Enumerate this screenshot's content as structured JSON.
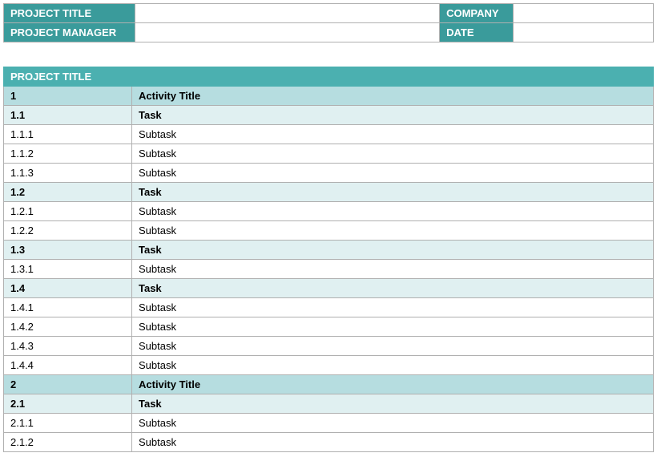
{
  "header": {
    "projectTitleLabel": "PROJECT TITLE",
    "projectTitleValue": "",
    "companyLabel": "COMPANY",
    "companyValue": "",
    "projectManagerLabel": "PROJECT MANAGER",
    "projectManagerValue": "",
    "dateLabel": "DATE",
    "dateValue": ""
  },
  "section": {
    "title": "PROJECT TITLE"
  },
  "rows": [
    {
      "id": "1",
      "text": "Activity Title",
      "level": 0
    },
    {
      "id": "1.1",
      "text": "Task",
      "level": 1
    },
    {
      "id": "1.1.1",
      "text": "Subtask",
      "level": 2
    },
    {
      "id": "1.1.2",
      "text": "Subtask",
      "level": 2
    },
    {
      "id": "1.1.3",
      "text": "Subtask",
      "level": 2
    },
    {
      "id": "1.2",
      "text": "Task",
      "level": 1
    },
    {
      "id": "1.2.1",
      "text": "Subtask",
      "level": 2
    },
    {
      "id": "1.2.2",
      "text": "Subtask",
      "level": 2
    },
    {
      "id": "1.3",
      "text": "Task",
      "level": 1
    },
    {
      "id": "1.3.1",
      "text": "Subtask",
      "level": 2
    },
    {
      "id": "1.4",
      "text": "Task",
      "level": 1
    },
    {
      "id": "1.4.1",
      "text": "Subtask",
      "level": 2
    },
    {
      "id": "1.4.2",
      "text": "Subtask",
      "level": 2
    },
    {
      "id": "1.4.3",
      "text": "Subtask",
      "level": 2
    },
    {
      "id": "1.4.4",
      "text": "Subtask",
      "level": 2
    },
    {
      "id": "2",
      "text": "Activity Title",
      "level": 0
    },
    {
      "id": "2.1",
      "text": "Task",
      "level": 1
    },
    {
      "id": "2.1.1",
      "text": "Subtask",
      "level": 2
    },
    {
      "id": "2.1.2",
      "text": "Subtask",
      "level": 2
    }
  ]
}
